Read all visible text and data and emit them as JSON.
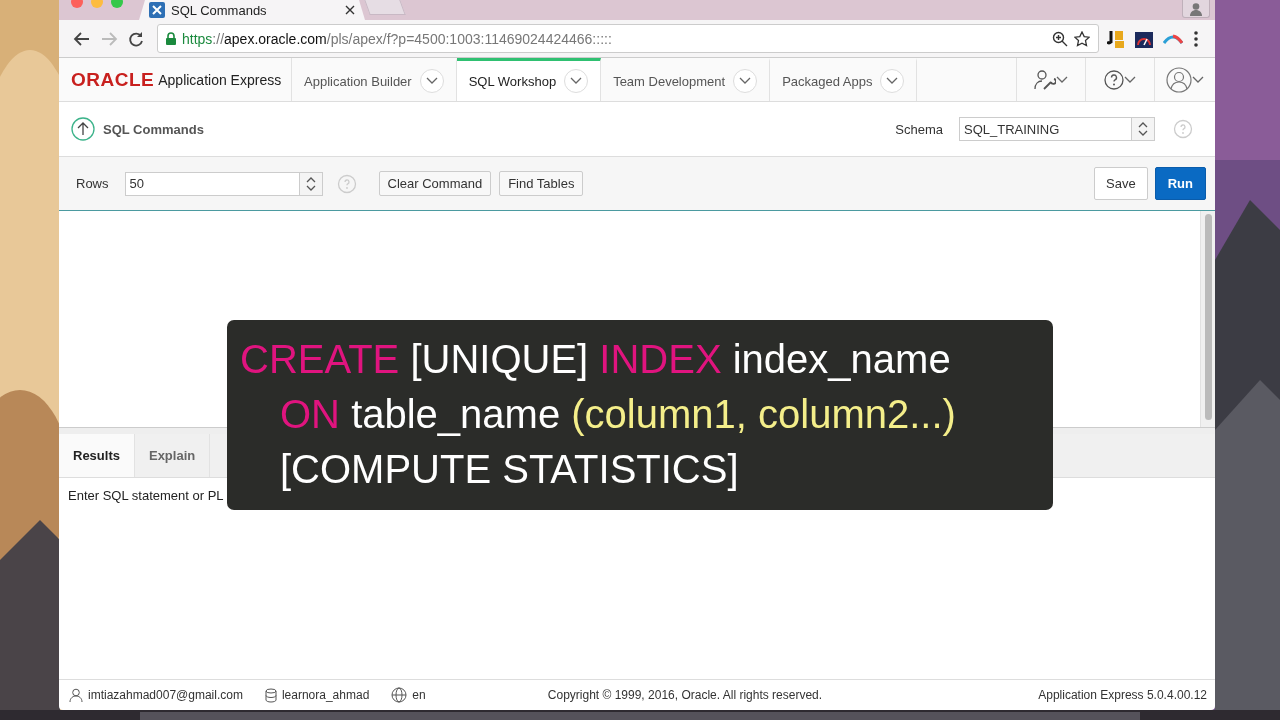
{
  "browser": {
    "tab": {
      "title": "SQL Commands"
    },
    "url": {
      "scheme": "https",
      "separator": "://",
      "host": "apex.oracle.com",
      "path": "/pls/apex/f?p=4500:1003:11469024424466:::::"
    }
  },
  "apex": {
    "brand": {
      "logo": "ORACLE",
      "product": "Application Express"
    },
    "nav": [
      {
        "label": "Application Builder",
        "selected": false
      },
      {
        "label": "SQL Workshop",
        "selected": true
      },
      {
        "label": "Team Development",
        "selected": false
      },
      {
        "label": "Packaged Apps",
        "selected": false
      }
    ],
    "page": {
      "title": "SQL Commands",
      "schema": {
        "label": "Schema",
        "value": "SQL_TRAINING"
      }
    },
    "toolbar": {
      "rows_label": "Rows",
      "rows_value": "50",
      "left_buttons": [
        {
          "label": "Clear Command",
          "kind": "default"
        },
        {
          "label": "Find Tables",
          "kind": "default"
        }
      ],
      "right_buttons": [
        {
          "label": "Save",
          "kind": "default"
        },
        {
          "label": "Run",
          "kind": "primary"
        }
      ]
    },
    "result_tabs": [
      {
        "label": "Results",
        "selected": true
      },
      {
        "label": "Explain",
        "selected": false
      }
    ],
    "message": "Enter SQL statement or PL",
    "footer": {
      "user": "imtiazahmad007@gmail.com",
      "workspace": "learnora_ahmad",
      "language": "en",
      "copyright": "Copyright © 1999, 2016, Oracle. All rights reserved.",
      "version": "Application Express 5.0.4.00.12"
    }
  },
  "overlay": {
    "lines": [
      [
        {
          "text": "CREATE",
          "kind": "keyword"
        },
        {
          "text": "[UNIQUE]",
          "kind": "plain"
        },
        {
          "text": "INDEX",
          "kind": "keyword"
        },
        {
          "text": "index_name",
          "kind": "plain"
        }
      ],
      [
        {
          "text": "ON",
          "kind": "keyword"
        },
        {
          "text": "table_name",
          "kind": "plain"
        },
        {
          "text": "(column1, column2...)",
          "kind": "param"
        }
      ],
      [
        {
          "text": "[COMPUTE STATISTICS]",
          "kind": "plain"
        }
      ]
    ]
  }
}
